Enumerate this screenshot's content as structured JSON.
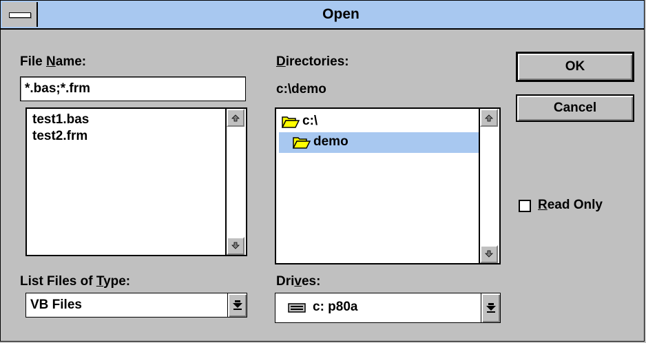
{
  "window": {
    "title": "Open"
  },
  "file_name": {
    "label_pre": "File ",
    "label_u": "N",
    "label_post": "ame:",
    "value": "*.bas;*.frm",
    "files": [
      "test1.bas",
      "test2.frm"
    ]
  },
  "directories": {
    "label_u": "D",
    "label_post": "irectories:",
    "current_path": "c:\\demo",
    "items": [
      "c:\\",
      "demo"
    ]
  },
  "buttons": {
    "ok": "OK",
    "cancel": "Cancel"
  },
  "read_only": {
    "label_u": "R",
    "label_post": "ead Only",
    "checked": false
  },
  "file_type": {
    "label_pre": "List Files of ",
    "label_u": "T",
    "label_post": "ype:",
    "value": "VB Files"
  },
  "drives": {
    "label_pre": "Dri",
    "label_u": "v",
    "label_post": "es:",
    "value": "c: p80a"
  },
  "colors": {
    "titlebar": "#a8c8f0",
    "selection": "#a8c8f0",
    "face": "#c0c0c0",
    "folder": "#ffff00"
  },
  "icons": {
    "system_menu": "system-menu-icon",
    "scroll_up": "scroll-up-icon",
    "scroll_down": "scroll-down-icon",
    "folder_open": "open-folder-icon",
    "dropdown": "dropdown-arrow-icon",
    "drive": "hard-drive-icon"
  }
}
